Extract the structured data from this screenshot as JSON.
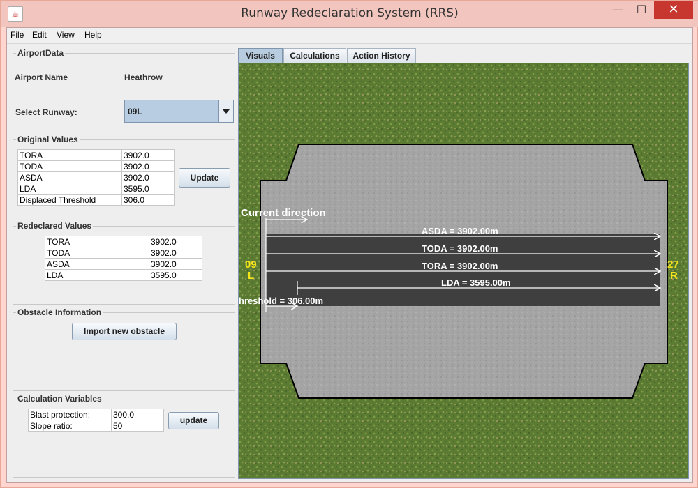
{
  "window": {
    "title": "Runway Redeclaration System (RRS)",
    "minimize": "—",
    "maximize": "☐",
    "close": "✕"
  },
  "menu": {
    "file": "File",
    "edit": "Edit",
    "view": "View",
    "help": "Help"
  },
  "airport": {
    "group_title": "AirportData",
    "name_label": "Airport Name",
    "name_value": "Heathrow",
    "runway_label": "Select Runway:",
    "runway_value": "09L"
  },
  "original": {
    "group_title": "Original Values",
    "rows": [
      {
        "name": "TORA",
        "value": "3902.0"
      },
      {
        "name": "TODA",
        "value": "3902.0"
      },
      {
        "name": "ASDA",
        "value": "3902.0"
      },
      {
        "name": "LDA",
        "value": "3595.0"
      },
      {
        "name": "Displaced Threshold",
        "value": "306.0"
      }
    ],
    "update_label": "Update"
  },
  "redeclared": {
    "group_title": "Redeclared Values",
    "rows": [
      {
        "name": "TORA",
        "value": "3902.0"
      },
      {
        "name": "TODA",
        "value": "3902.0"
      },
      {
        "name": "ASDA",
        "value": "3902.0"
      },
      {
        "name": "LDA",
        "value": "3595.0"
      }
    ]
  },
  "obstacle": {
    "group_title": "Obstacle Information",
    "import_label": "Import new obstacle"
  },
  "calc_vars": {
    "group_title": "Calculation Variables",
    "rows": [
      {
        "name": "Blast protection:",
        "value": "300.0"
      },
      {
        "name": "Slope ratio:",
        "value": "50"
      }
    ],
    "update_label": "update"
  },
  "tabs": [
    "Visuals",
    "Calculations",
    "Action History"
  ],
  "visual": {
    "current_direction": "Current direction",
    "asda": "ASDA = 3902.00m",
    "toda": "TODA = 3902.00m",
    "tora": "TORA = 3902.00m",
    "lda": "LDA = 3595.00m",
    "threshold": "hreshold = 306.00m",
    "left_designator": "09",
    "left_letter": "L",
    "right_designator": "27",
    "right_letter": "R",
    "colors": {
      "grass": "#5a7a32",
      "apron": "#a6a6a6",
      "runway": "#3f3f3f",
      "designator": "#f5e41b"
    }
  }
}
